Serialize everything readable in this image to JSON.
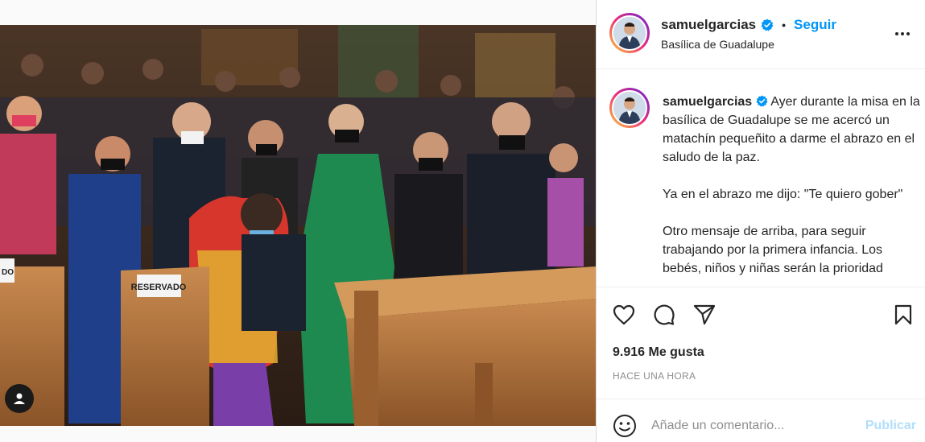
{
  "post": {
    "username": "samuelgarcias",
    "follow_label": "Seguir",
    "location": "Basílica de Guadalupe",
    "caption_paragraphs": [
      "Ayer durante la misa en la basílica de Guadalupe se me acercó un matachín pequeñito a darme el abrazo en el saludo de la paz.",
      "Ya en el abrazo me dijo: \"Te quiero gober\"",
      "Otro mensaje de arriba, para seguir trabajando por la primera infancia. Los bebés, niños y niñas serán la prioridad"
    ],
    "photo_sign_left": "RESERVADO",
    "photo_sign_edge": "DO"
  },
  "engagement": {
    "likes": "9.916 Me gusta",
    "timestamp": "HACE UNA HORA"
  },
  "comment": {
    "placeholder": "Añade un comentario...",
    "publish_label": "Publicar"
  },
  "colors": {
    "accent": "#0095f6",
    "publish_disabled": "#b2dffc",
    "text": "#262626",
    "secondary": "#8e8e8e"
  },
  "icons": [
    "verified-icon",
    "more-icon",
    "heart-icon",
    "comment-icon",
    "share-icon",
    "bookmark-icon",
    "emoji-icon",
    "user-tag-icon"
  ]
}
